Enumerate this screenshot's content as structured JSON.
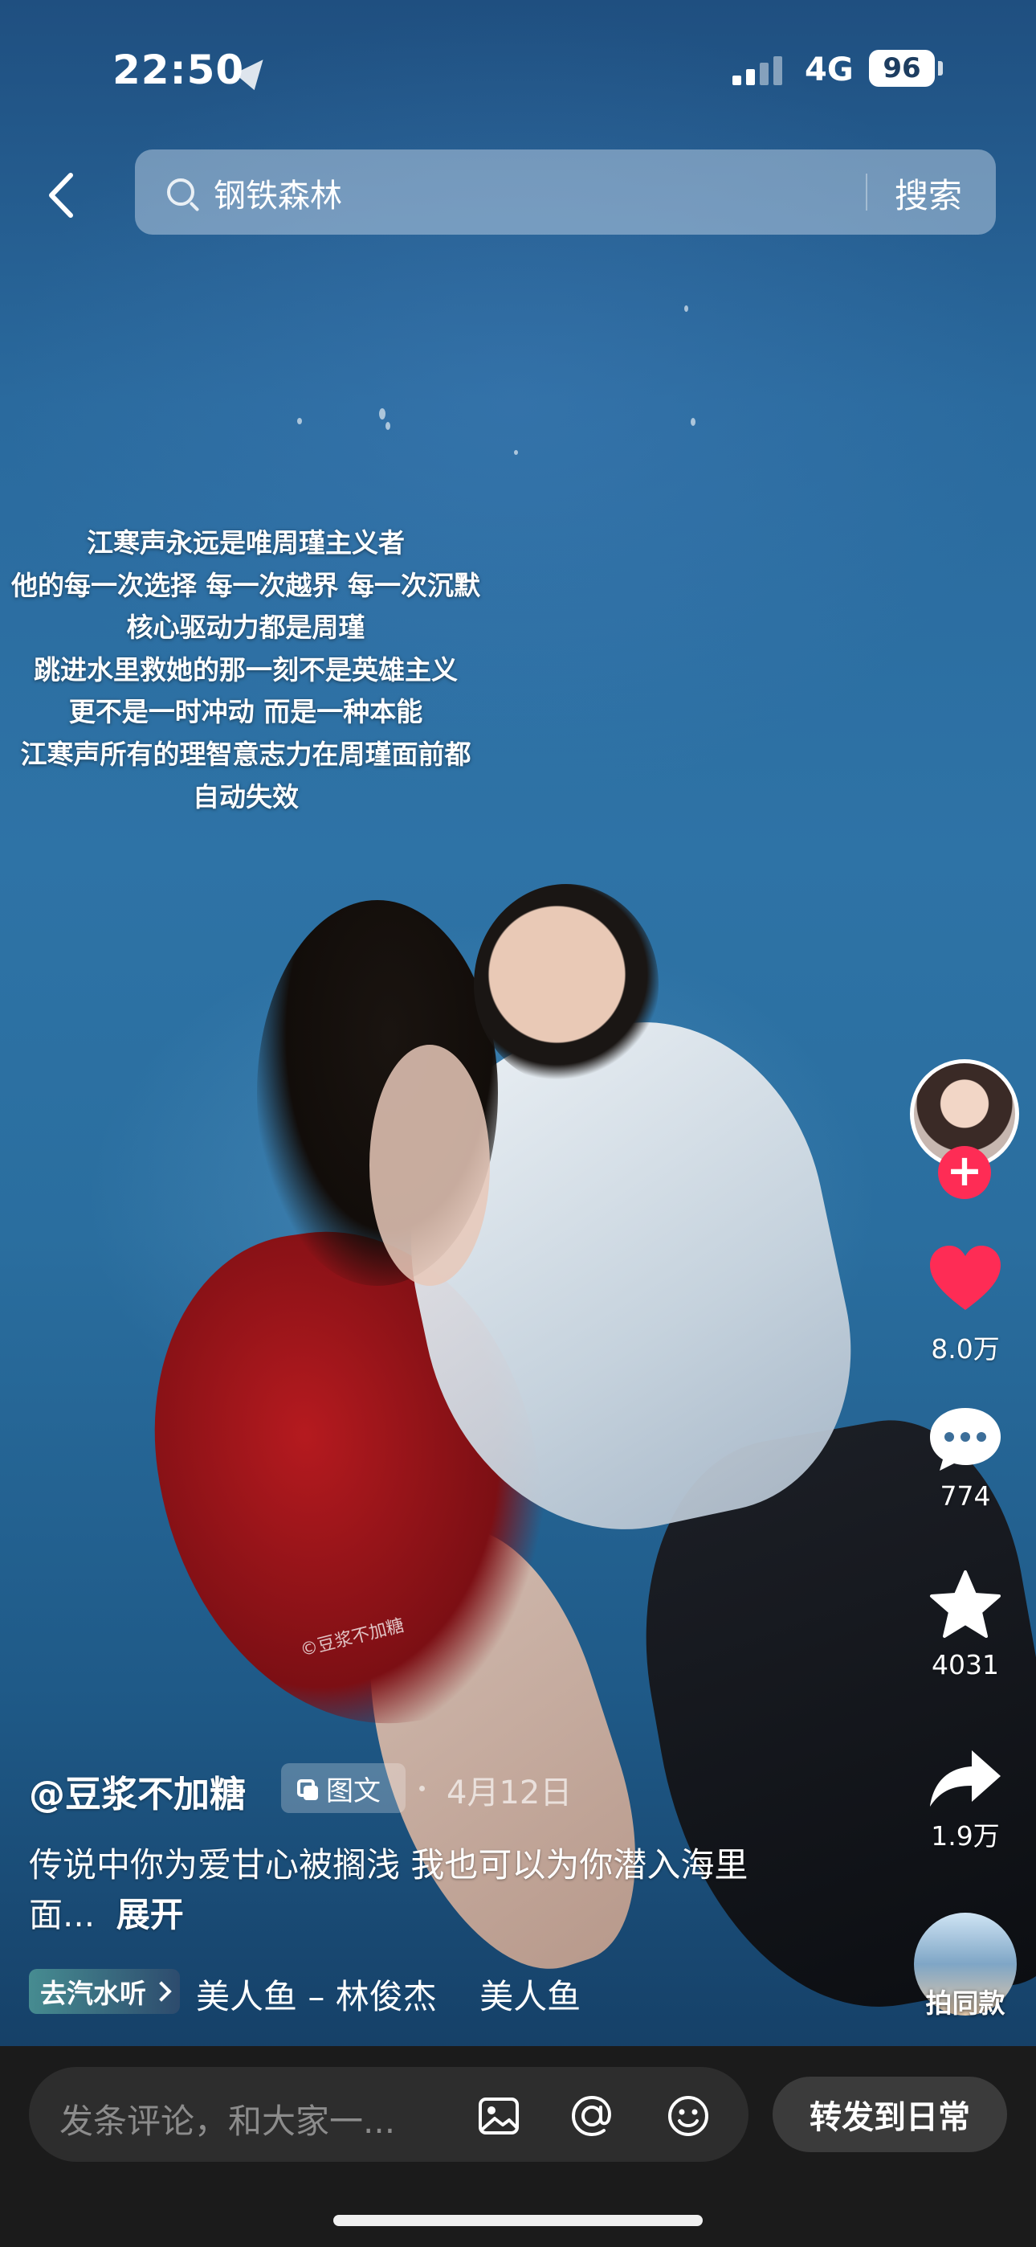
{
  "status_bar": {
    "time": "22:50",
    "network": "4G",
    "battery": "96"
  },
  "search": {
    "query": "钢铁森林",
    "button_label": "搜索"
  },
  "overlay_text": [
    "江寒声永远是唯周瑾主义者",
    "他的每一次选择 每一次越界 每一次沉默",
    "核心驱动力都是周瑾",
    "跳进水里救她的那一刻不是英雄主义",
    "更不是一时冲动 而是一种本能",
    "江寒声所有的理智意志力在周瑾面前都",
    "自动失效"
  ],
  "watermark": "©豆浆不加糖",
  "actions": {
    "follow_label": "+",
    "likes": "8.0万",
    "comments": "774",
    "favorites": "4031",
    "shares": "1.9万",
    "same_style_label": "拍同款"
  },
  "post": {
    "author": "@豆浆不加糖",
    "type_tag": "图文",
    "date": "4月12日",
    "description": "传说中你为爱甘心被搁浅 我也可以为你潜入海里面...",
    "expand_label": "展开"
  },
  "music": {
    "tag_label": "去汽水听",
    "track": "美人鱼 – 林俊杰",
    "track_extra": "美人鱼"
  },
  "comment_bar": {
    "placeholder": "发条评论，和大家一...",
    "forward_label": "转发到日常"
  },
  "colors": {
    "accent_red": "#fe2c55",
    "comment_bar_bg": "#1b1b1b"
  }
}
